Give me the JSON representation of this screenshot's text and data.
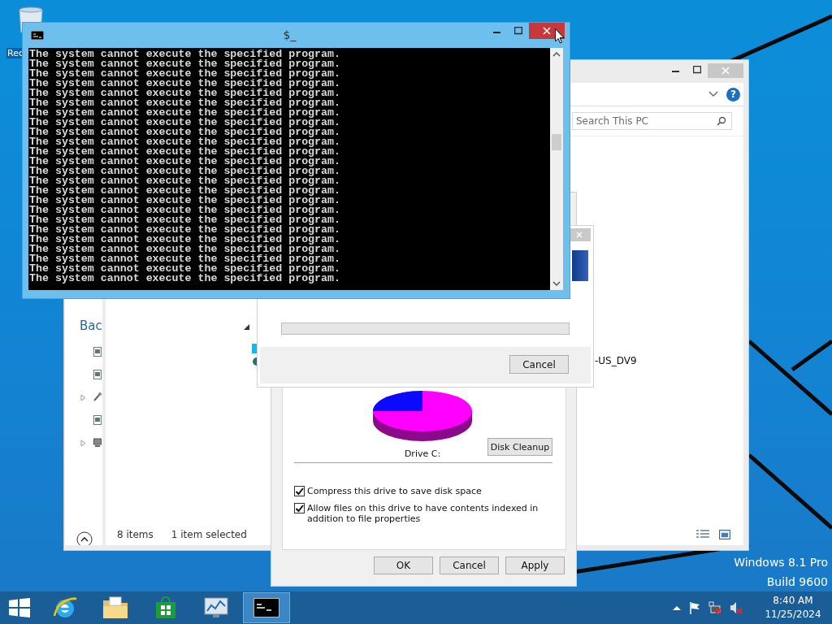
{
  "desktop": {
    "icon_label": "Rec",
    "edition": "Windows 8.1 Pro",
    "build": "Build 9600"
  },
  "explorer": {
    "help_button": "?",
    "search": {
      "placeholder": "Search This PC"
    },
    "nav_text": "Bac",
    "item_text": "-US_DV9",
    "status": {
      "count": "8 items",
      "selection": "1 item selected"
    }
  },
  "properties": {
    "drive_label": "Drive C:",
    "cleanup_button": "Disk Cleanup",
    "options": [
      {
        "label": "Compress this drive to save disk space",
        "checked": true
      },
      {
        "label": "Allow files on this drive to have contents indexed in addition to file properties",
        "checked": true
      }
    ],
    "buttons": [
      "OK",
      "Cancel",
      "Apply"
    ]
  },
  "progress_dialog": {
    "level": 0,
    "buttons": [
      "Cancel"
    ]
  },
  "console": {
    "title": "$_",
    "lines": [
      "The system cannot execute the specified program.",
      "The system cannot execute the specified program.",
      "The system cannot execute the specified program.",
      "The system cannot execute the specified program.",
      "The system cannot execute the specified program.",
      "The system cannot execute the specified program.",
      "The system cannot execute the specified program.",
      "The system cannot execute the specified program.",
      "The system cannot execute the specified program.",
      "The system cannot execute the specified program.",
      "The system cannot execute the specified program.",
      "The system cannot execute the specified program.",
      "The system cannot execute the specified program.",
      "The system cannot execute the specified program.",
      "The system cannot execute the specified program.",
      "The system cannot execute the specified program.",
      "The system cannot execute the specified program.",
      "The system cannot execute the specified program.",
      "The system cannot execute the specified program.",
      "The system cannot execute the specified program.",
      "The system cannot execute the specified program.",
      "The system cannot execute the specified program.",
      "The system cannot execute the specified program.",
      "The system cannot execute the specified program."
    ]
  },
  "taskbar": {
    "apps": [
      {
        "kind": "browser",
        "selected": false
      },
      {
        "kind": "files",
        "selected": false
      },
      {
        "kind": "store",
        "selected": false
      },
      {
        "kind": "monitor",
        "selected": false
      },
      {
        "kind": "console",
        "selected": true
      }
    ],
    "clock": {
      "time": "8:40 AM",
      "date": "11/25/2024"
    }
  }
}
